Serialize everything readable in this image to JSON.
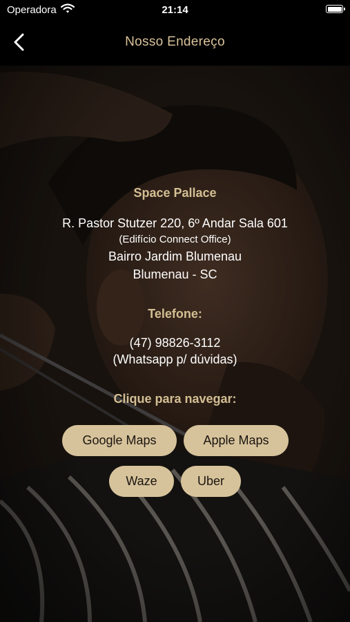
{
  "status_bar": {
    "carrier": "Operadora",
    "time": "21:14"
  },
  "nav": {
    "title": "Nosso Endereço"
  },
  "address": {
    "name": "Space Pallace",
    "line1": "R. Pastor Stutzer 220, 6º Andar Sala 601",
    "line2": "(Edifício Connect Office)",
    "line3": "Bairro Jardim Blumenau",
    "line4": "Blumenau - SC"
  },
  "phone": {
    "heading": "Telefone:",
    "number": "(47) 98826-3112",
    "note": "(Whatsapp p/ dúvidas)"
  },
  "navigate": {
    "heading": "Clique para navegar:",
    "buttons": [
      "Google Maps",
      "Apple Maps",
      "Waze",
      "Uber"
    ]
  },
  "colors": {
    "accent": "#d7c39b",
    "heading": "#d4bf94",
    "title": "#d9c29a"
  }
}
